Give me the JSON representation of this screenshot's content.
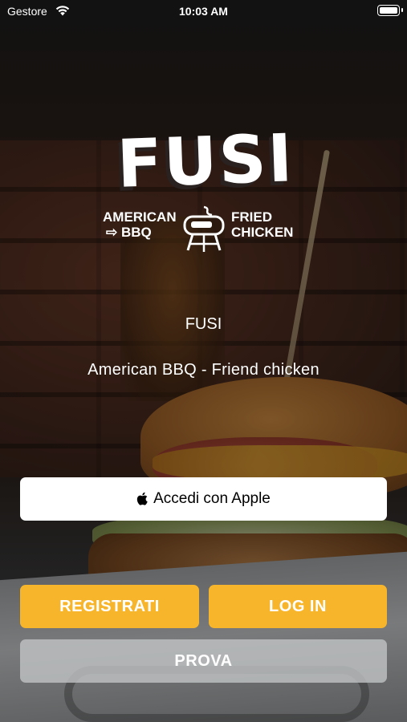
{
  "status_bar": {
    "carrier": "Gestore",
    "time": "10:03 AM"
  },
  "logo": {
    "wordmark": "FUSI",
    "left_line1": "AMERICAN",
    "left_line2": "BBQ",
    "right_line1": "FRIED",
    "right_line2": "CHICKEN"
  },
  "app": {
    "name": "FUSI",
    "tagline": "American BBQ - Friend chicken"
  },
  "buttons": {
    "apple_label": "Accedi con Apple",
    "register_label": "REGISTRATI",
    "login_label": "LOG IN",
    "try_label": "PROVA"
  },
  "colors": {
    "accent": "#f7b52b",
    "secondary_button": "#c3c5c7"
  }
}
